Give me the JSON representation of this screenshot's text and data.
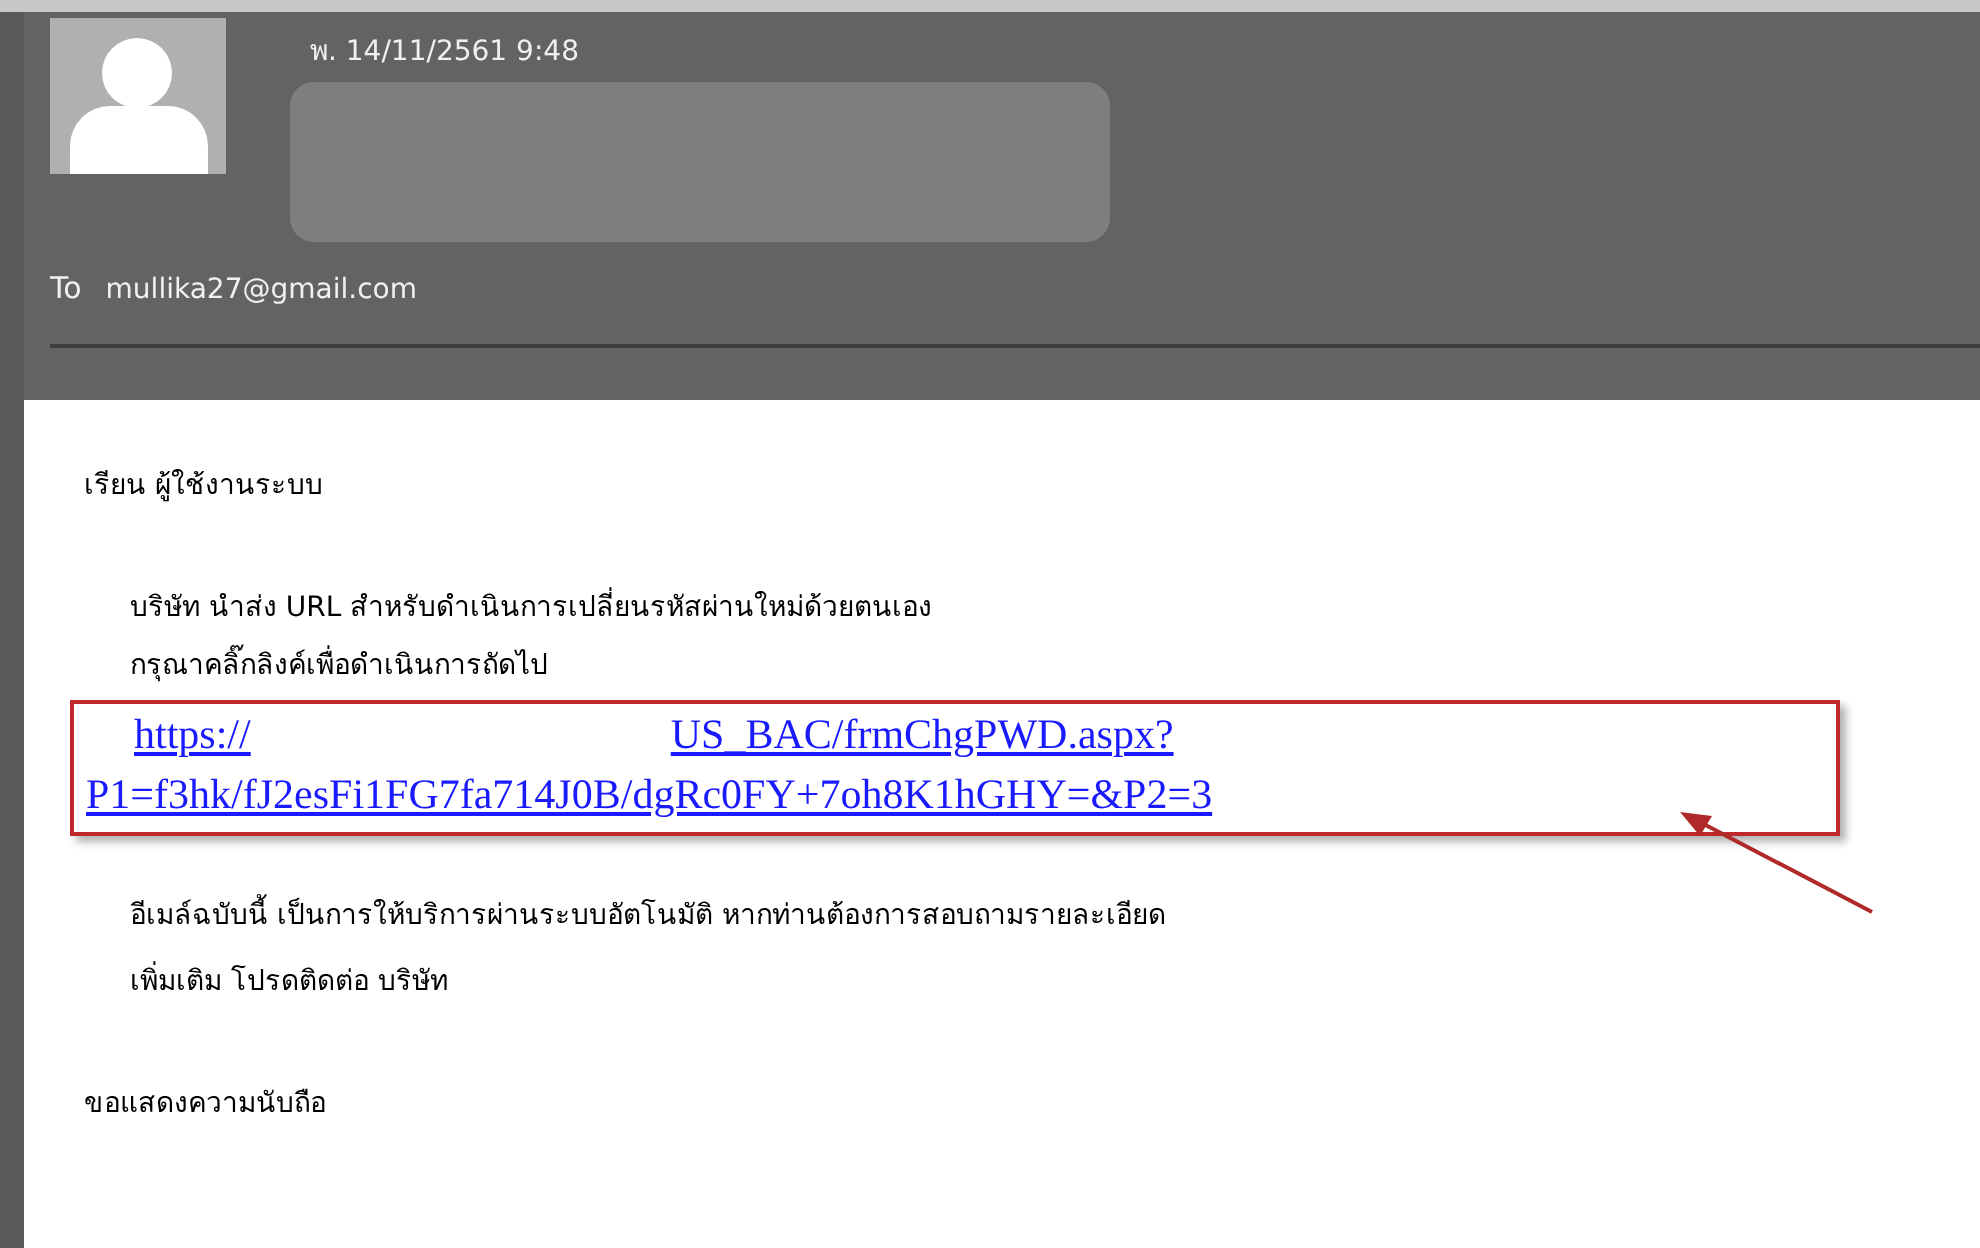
{
  "header": {
    "date": "พ. 14/11/2561 9:48",
    "to_label": "To",
    "to_address": "mullika27@gmail.com"
  },
  "body": {
    "greeting": "เรียน ผู้ใช้งานระบบ",
    "intro_lines": [
      "บริษัท นำส่ง URL สำหรับดำเนินการเปลี่ยนรหัสผ่านใหม่ด้วยตนเอง",
      "กรุณาคลิ๊กลิงค์เพื่อดำเนินการถัดไป"
    ],
    "link": {
      "start": "https://",
      "after_redaction": "US_BAC/frmChgPWD.aspx?",
      "line_2": "P1=f3hk/fJ2esFi1FG7fa714J0B/dgRc0FY+7oh8K1hGHY=&P2=3"
    },
    "note_lines": [
      "อีเมล์ฉบับนี้ เป็นการให้บริการผ่านระบบอัตโนมัติ หากท่านต้องการสอบถามรายละเอียด",
      "เพิ่มเติม โปรดติดต่อ บริษัท"
    ],
    "closing": "ขอแสดงความนับถือ"
  }
}
